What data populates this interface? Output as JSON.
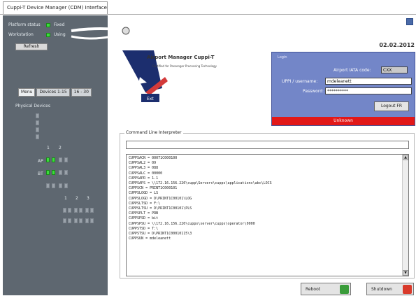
{
  "window": {
    "title": "Cuppi-T Device Manager (CDM) Interface"
  },
  "status": {
    "platform_label": "Platform status",
    "platform_value": "Fixed",
    "workstation_label": "Workstation",
    "workstation_value": "Using",
    "refresh_label": "Refresh"
  },
  "sidebar": {
    "tabs": [
      {
        "label": "Menu"
      },
      {
        "label": "Devices 1-15"
      },
      {
        "label": "16 - 30"
      }
    ],
    "physical_devices_label": "Physical Devices",
    "device_labels": {
      "col1": "1",
      "col2": "2",
      "row_ap": "AP",
      "row_bt": "BT",
      "n1": "1",
      "n2": "2",
      "n3": "3"
    }
  },
  "header": {
    "date": "02.02.2012"
  },
  "logo": {
    "title": "Airport Manager Cuppi-T",
    "subtitle": "Certified for Passenger Processing Technology",
    "badge": "Ext"
  },
  "login": {
    "title": "Login",
    "airport_label": "Airport IATA code:",
    "airport_value": "CXX",
    "user_label": "UPPI / username:",
    "user_value": "mdeleanett",
    "password_label": "Password:",
    "password_value": "**********",
    "logout_label": "Logout FR",
    "status_text": "Unknown"
  },
  "command": {
    "legend": "Command Line Interpreter",
    "input_value": "",
    "lines": [
      "CUPPSACN = 00071C000100",
      "CUPPSAL2 = 09",
      "CUPPSAL3 = 088",
      "CUPPSALC = 00000",
      "CUPPSAPR = 1.1",
      "CUPPSAPS = \\\\172.16.156.220\\cupp\\Servers\\cupps\\applications\\abc\\LOCS",
      "CUPPSCN = PRINT1C000101",
      "CUPPSLOGD = LS",
      "CUPPSLOGD = D\\PRINT1C00101\\LOG",
      "CUPPSLTSD = F:\\",
      "CUPPSLTSU = D\\PRINT1C00101\\PLS",
      "CUPPSPLT = PRB",
      "CUPPSPSD = bit",
      "CUPPSPSU = \\\\172.16.156.220\\cupps\\server\\cupps\\operator\\0000",
      "CUPPSTSD = T:\\",
      "CUPPSTSU = D\\PRINT1C00010115\\3",
      "CUPPSUN = mdeleanett"
    ]
  },
  "buttons": {
    "reboot": "Reboot",
    "shutdown": "Shutdown"
  },
  "colors": {
    "sidebar_bg": "#5e6770",
    "login_bg": "#7386c8",
    "status_red": "#e21818",
    "led_green": "#3cdc3c"
  }
}
